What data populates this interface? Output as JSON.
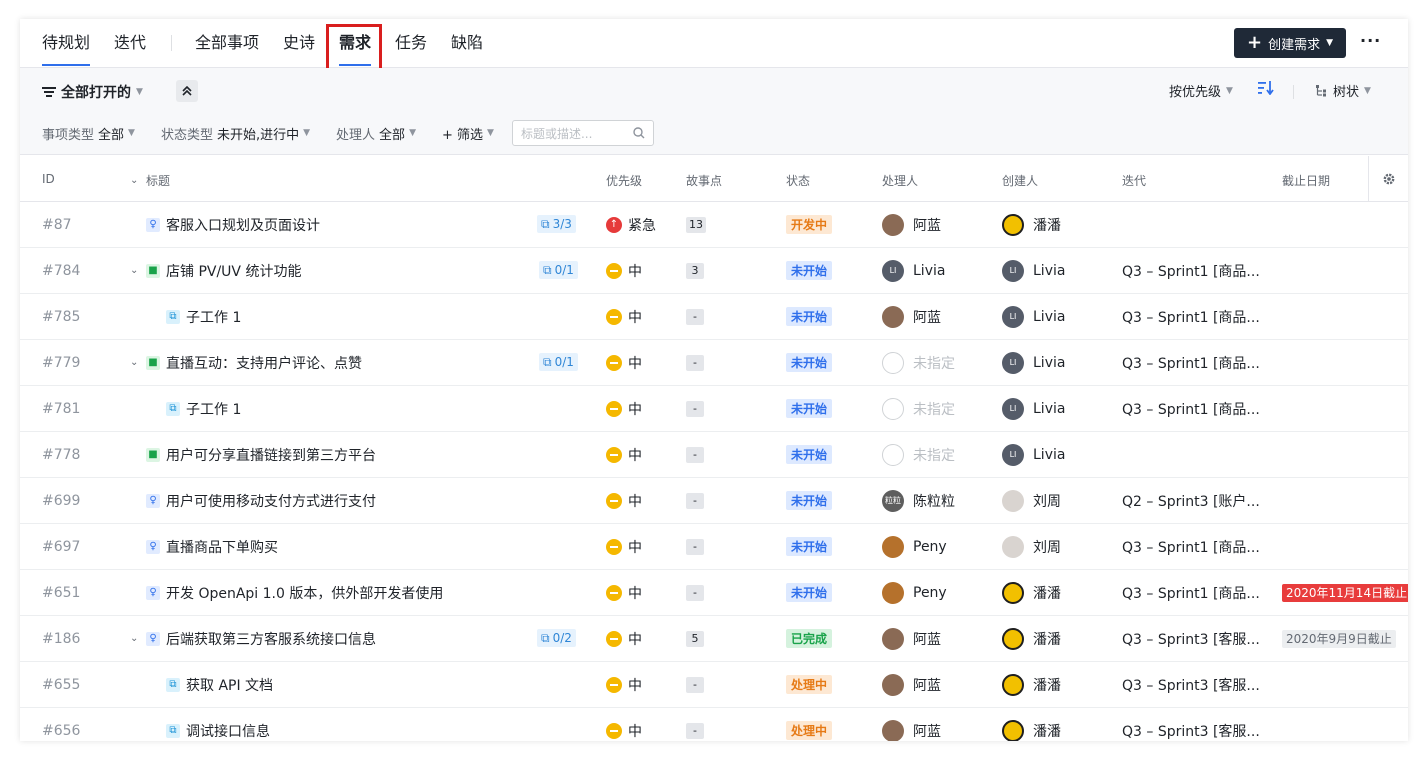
{
  "top_tabs": [
    {
      "label": "待规划"
    },
    {
      "label": "迭代"
    },
    {
      "label": "全部事项"
    },
    {
      "label": "史诗"
    },
    {
      "label": "需求"
    },
    {
      "label": "任务"
    },
    {
      "label": "缺陷"
    }
  ],
  "active_tab": "需求",
  "create_button": {
    "label": "创建需求"
  },
  "more_button": {
    "label": "···"
  },
  "filters": {
    "view_label": "全部打开的",
    "item_type": {
      "label": "事项类型",
      "value": "全部"
    },
    "status_type": {
      "label": "状态类型",
      "value": "未开始,进行中"
    },
    "assignee": {
      "label": "处理人",
      "value": "全部"
    },
    "add_filter": "+ 筛选",
    "search_placeholder": "标题或描述...",
    "sort_label": "按优先级",
    "layout_label": "树状"
  },
  "columns": {
    "id": "ID",
    "title": "标题",
    "priority": "优先级",
    "points": "故事点",
    "status": "状态",
    "assignee": "处理人",
    "creator": "创建人",
    "iteration": "迭代",
    "due": "截止日期"
  },
  "rows": [
    {
      "id": "#87",
      "type": "req",
      "indent": 0,
      "expand": false,
      "title": "客服入口规划及页面设计",
      "subcount": "3/3",
      "priority": "紧急",
      "prio_level": "urgent",
      "points": "13",
      "status": "开发中",
      "status_kind": "dev",
      "assignee": "阿蓝",
      "assignee_av": "alan",
      "creator": "潘潘",
      "creator_av": "panpan",
      "iteration": "",
      "due": "",
      "due_kind": ""
    },
    {
      "id": "#784",
      "type": "story",
      "indent": 0,
      "expand": true,
      "title": "店铺 PV/UV 统计功能",
      "subcount": "0/1",
      "priority": "中",
      "prio_level": "mid",
      "points": "3",
      "status": "未开始",
      "status_kind": "notstart",
      "assignee": "Livia",
      "assignee_av": "livia",
      "creator": "Livia",
      "creator_av": "livia",
      "iteration": "Q3 – Sprint1 [商品...",
      "due": "",
      "due_kind": ""
    },
    {
      "id": "#785",
      "type": "sub",
      "indent": 1,
      "expand": false,
      "title": "子工作 1",
      "subcount": "",
      "priority": "中",
      "prio_level": "mid",
      "points": "-",
      "status": "未开始",
      "status_kind": "notstart",
      "assignee": "阿蓝",
      "assignee_av": "alan",
      "creator": "Livia",
      "creator_av": "livia",
      "iteration": "Q3 – Sprint1 [商品...",
      "due": "",
      "due_kind": ""
    },
    {
      "id": "#779",
      "type": "story",
      "indent": 0,
      "expand": true,
      "title": "直播互动：支持用户评论、点赞",
      "subcount": "0/1",
      "priority": "中",
      "prio_level": "mid",
      "points": "-",
      "status": "未开始",
      "status_kind": "notstart",
      "assignee": "未指定",
      "assignee_av": "none",
      "creator": "Livia",
      "creator_av": "livia",
      "iteration": "Q3 – Sprint1 [商品...",
      "due": "",
      "due_kind": ""
    },
    {
      "id": "#781",
      "type": "sub",
      "indent": 1,
      "expand": false,
      "title": "子工作 1",
      "subcount": "",
      "priority": "中",
      "prio_level": "mid",
      "points": "-",
      "status": "未开始",
      "status_kind": "notstart",
      "assignee": "未指定",
      "assignee_av": "none",
      "creator": "Livia",
      "creator_av": "livia",
      "iteration": "Q3 – Sprint1 [商品...",
      "due": "",
      "due_kind": ""
    },
    {
      "id": "#778",
      "type": "story",
      "indent": 0,
      "expand": false,
      "title": "用户可分享直播链接到第三方平台",
      "subcount": "",
      "priority": "中",
      "prio_level": "mid",
      "points": "-",
      "status": "未开始",
      "status_kind": "notstart",
      "assignee": "未指定",
      "assignee_av": "none",
      "creator": "Livia",
      "creator_av": "livia",
      "iteration": "",
      "due": "",
      "due_kind": ""
    },
    {
      "id": "#699",
      "type": "req",
      "indent": 0,
      "expand": false,
      "title": "用户可使用移动支付方式进行支付",
      "subcount": "",
      "priority": "中",
      "prio_level": "mid",
      "points": "-",
      "status": "未开始",
      "status_kind": "notstart",
      "assignee": "陈粒粒",
      "assignee_av": "chen",
      "creator": "刘周",
      "creator_av": "liu",
      "iteration": "Q2 – Sprint3 [账户...",
      "due": "",
      "due_kind": ""
    },
    {
      "id": "#697",
      "type": "req",
      "indent": 0,
      "expand": false,
      "title": "直播商品下单购买",
      "subcount": "",
      "priority": "中",
      "prio_level": "mid",
      "points": "-",
      "status": "未开始",
      "status_kind": "notstart",
      "assignee": "Peny",
      "assignee_av": "peny",
      "creator": "刘周",
      "creator_av": "liu",
      "iteration": "Q3 – Sprint1 [商品...",
      "due": "",
      "due_kind": ""
    },
    {
      "id": "#651",
      "type": "req",
      "indent": 0,
      "expand": false,
      "title": "开发 OpenApi 1.0 版本，供外部开发者使用",
      "subcount": "",
      "priority": "中",
      "prio_level": "mid",
      "points": "-",
      "status": "未开始",
      "status_kind": "notstart",
      "assignee": "Peny",
      "assignee_av": "peny",
      "creator": "潘潘",
      "creator_av": "panpan",
      "iteration": "Q3 – Sprint1 [商品...",
      "due": "2020年11月14日截止",
      "due_kind": "over"
    },
    {
      "id": "#186",
      "type": "req",
      "indent": 0,
      "expand": true,
      "title": "后端获取第三方客服系统接口信息",
      "subcount": "0/2",
      "priority": "中",
      "prio_level": "mid",
      "points": "5",
      "status": "已完成",
      "status_kind": "done",
      "assignee": "阿蓝",
      "assignee_av": "alan",
      "creator": "潘潘",
      "creator_av": "panpan",
      "iteration": "Q3 – Sprint3 [客服...",
      "due": "2020年9月9日截止",
      "due_kind": "normal"
    },
    {
      "id": "#655",
      "type": "sub",
      "indent": 1,
      "expand": false,
      "title": "获取 API 文档",
      "subcount": "",
      "priority": "中",
      "prio_level": "mid",
      "points": "-",
      "status": "处理中",
      "status_kind": "dev",
      "assignee": "阿蓝",
      "assignee_av": "alan",
      "creator": "潘潘",
      "creator_av": "panpan",
      "iteration": "Q3 – Sprint3 [客服...",
      "due": "",
      "due_kind": ""
    },
    {
      "id": "#656",
      "type": "sub",
      "indent": 1,
      "expand": false,
      "title": "调试接口信息",
      "subcount": "",
      "priority": "中",
      "prio_level": "mid",
      "points": "-",
      "status": "处理中",
      "status_kind": "dev",
      "assignee": "阿蓝",
      "assignee_av": "alan",
      "creator": "潘潘",
      "creator_av": "panpan",
      "iteration": "Q3 – Sprint3 [客服...",
      "due": "",
      "due_kind": ""
    }
  ]
}
